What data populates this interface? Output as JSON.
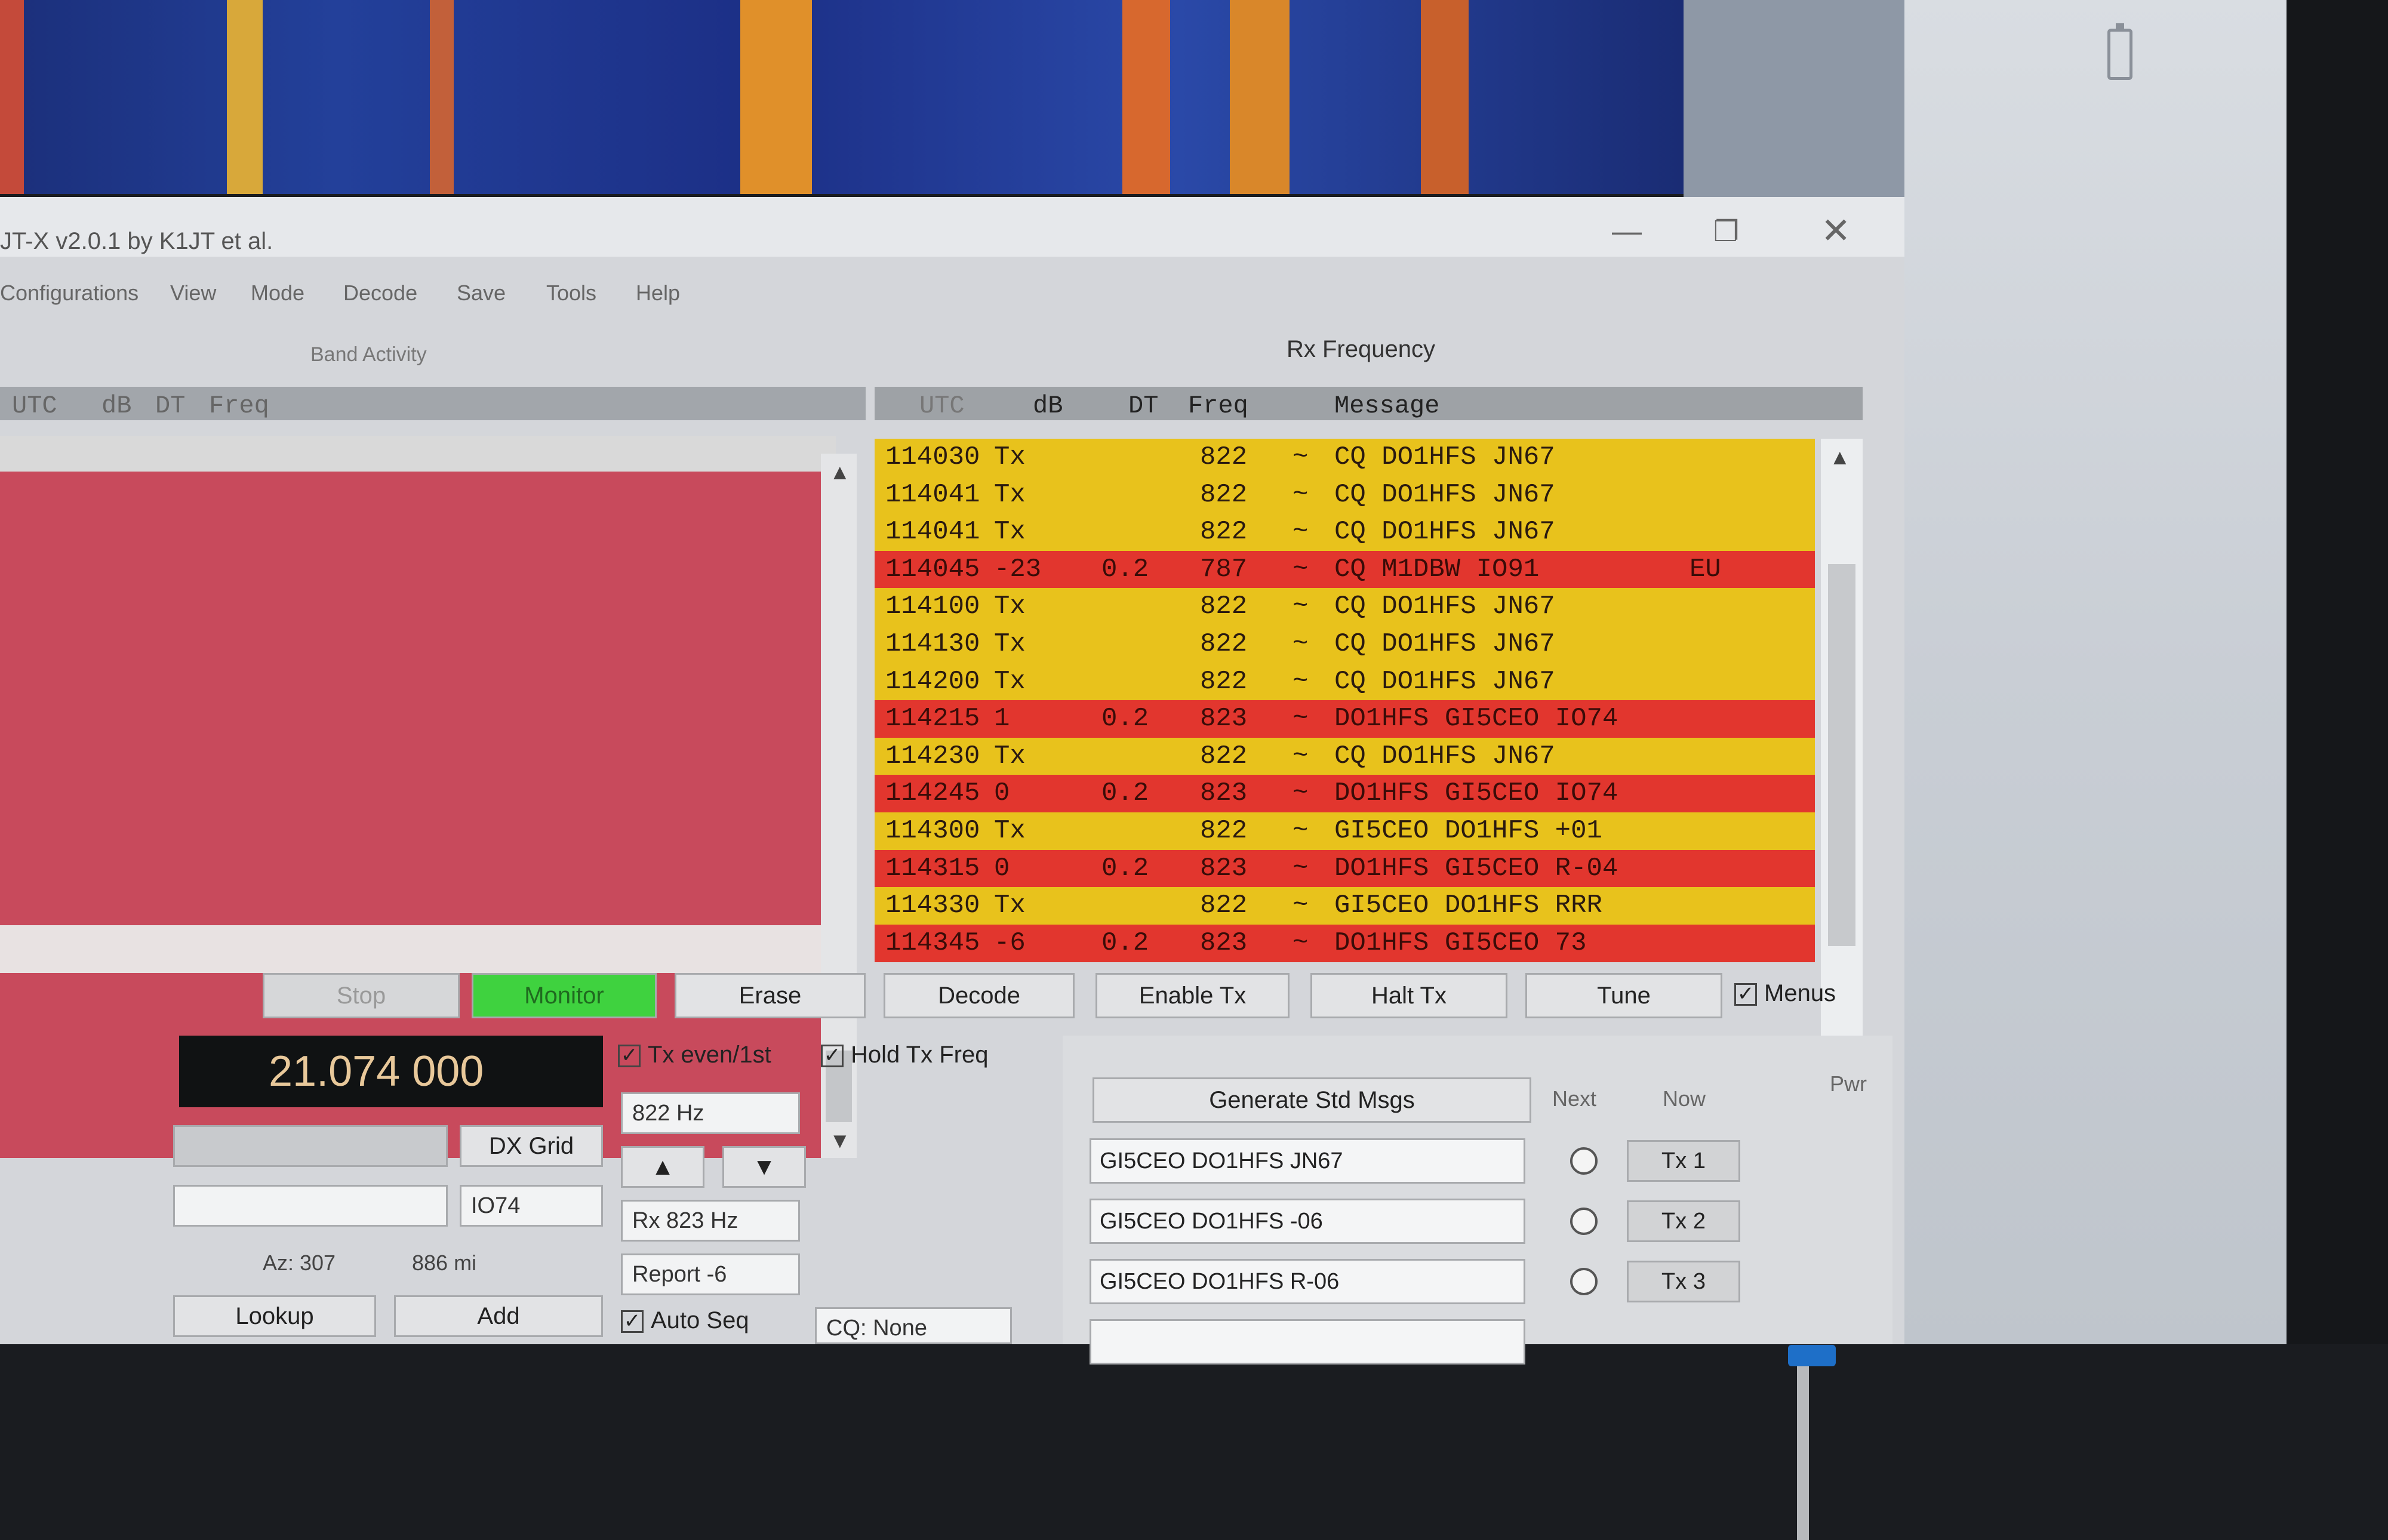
{
  "window": {
    "title": "JT-X  v2.0.1   by K1JT et al.",
    "controls": {
      "minimize": "—",
      "maximize": "❐",
      "close": "✕"
    }
  },
  "menu": [
    "Configurations",
    "View",
    "Mode",
    "Decode",
    "Save",
    "Tools",
    "Help"
  ],
  "panels": {
    "band_activity": "Band Activity",
    "rx_frequency": "Rx Frequency"
  },
  "band_activity_header": {
    "utc": "UTC",
    "db": "dB",
    "dt": "DT",
    "freq": "Freq"
  },
  "rx_table": {
    "headers": {
      "utc": "UTC",
      "db": "dB",
      "dt": "DT",
      "freq": "Freq",
      "message": "Message"
    },
    "rows": [
      {
        "utc": "114030",
        "db": "Tx",
        "dt": "",
        "freq": "822",
        "sep": "~",
        "message": "CQ DO1HFS JN67",
        "extra": "",
        "status": "tx"
      },
      {
        "utc": "114041",
        "db": "Tx",
        "dt": "",
        "freq": "822",
        "sep": "~",
        "message": "CQ DO1HFS JN67",
        "extra": "",
        "status": "tx"
      },
      {
        "utc": "114041",
        "db": "Tx",
        "dt": "",
        "freq": "822",
        "sep": "~",
        "message": "CQ DO1HFS JN67",
        "extra": "",
        "status": "tx"
      },
      {
        "utc": "114045",
        "db": "-23",
        "dt": "0.2",
        "freq": "787",
        "sep": "~",
        "message": "CQ M1DBW IO91",
        "extra": "EU",
        "status": "rx"
      },
      {
        "utc": "114100",
        "db": "Tx",
        "dt": "",
        "freq": "822",
        "sep": "~",
        "message": "CQ DO1HFS JN67",
        "extra": "",
        "status": "tx"
      },
      {
        "utc": "114130",
        "db": "Tx",
        "dt": "",
        "freq": "822",
        "sep": "~",
        "message": "CQ DO1HFS JN67",
        "extra": "",
        "status": "tx"
      },
      {
        "utc": "114200",
        "db": "Tx",
        "dt": "",
        "freq": "822",
        "sep": "~",
        "message": "CQ DO1HFS JN67",
        "extra": "",
        "status": "tx"
      },
      {
        "utc": "114215",
        "db": "1",
        "dt": "0.2",
        "freq": "823",
        "sep": "~",
        "message": "DO1HFS GI5CEO IO74",
        "extra": "",
        "status": "rx"
      },
      {
        "utc": "114230",
        "db": "Tx",
        "dt": "",
        "freq": "822",
        "sep": "~",
        "message": "CQ DO1HFS JN67",
        "extra": "",
        "status": "tx"
      },
      {
        "utc": "114245",
        "db": "0",
        "dt": "0.2",
        "freq": "823",
        "sep": "~",
        "message": "DO1HFS GI5CEO IO74",
        "extra": "",
        "status": "rx"
      },
      {
        "utc": "114300",
        "db": "Tx",
        "dt": "",
        "freq": "822",
        "sep": "~",
        "message": "GI5CEO DO1HFS +01",
        "extra": "",
        "status": "tx"
      },
      {
        "utc": "114315",
        "db": "0",
        "dt": "0.2",
        "freq": "823",
        "sep": "~",
        "message": "DO1HFS GI5CEO R-04",
        "extra": "",
        "status": "rx"
      },
      {
        "utc": "114330",
        "db": "Tx",
        "dt": "",
        "freq": "822",
        "sep": "~",
        "message": "GI5CEO DO1HFS RRR",
        "extra": "",
        "status": "tx"
      },
      {
        "utc": "114345",
        "db": "-6",
        "dt": "0.2",
        "freq": "823",
        "sep": "~",
        "message": "DO1HFS GI5CEO 73",
        "extra": "",
        "status": "rx"
      }
    ]
  },
  "colors": {
    "tx_row": "#e8c21c",
    "rx_row": "#e2362e",
    "monitor_on": "#3fd23f",
    "band_list": "#c84a5c"
  },
  "buttons": {
    "stop": "Stop",
    "monitor": "Monitor",
    "erase": "Erase",
    "decode": "Decode",
    "enable_tx": "Enable Tx",
    "halt_tx": "Halt Tx",
    "tune": "Tune",
    "menus": "Menus",
    "generate": "Generate Std Msgs",
    "dx_grid": "DX Grid",
    "lookup": "Lookup",
    "add": "Add"
  },
  "checks": {
    "tx_even": "Tx even/1st",
    "hold_tx": "Hold Tx Freq",
    "auto_seq": "Auto Seq"
  },
  "controls": {
    "dial_frequency": "21.074 000",
    "tx_freq": "822 Hz",
    "rx_freq": "Rx 823 Hz",
    "report": "Report -6",
    "grid": "IO74",
    "az_label": "Az: 307",
    "distance": "886 mi",
    "cq_select": "CQ: None"
  },
  "tx_panel": {
    "next_label": "Next",
    "now_label": "Now",
    "pwr_label": "Pwr",
    "messages": [
      {
        "text": "GI5CEO DO1HFS JN67",
        "button": "Tx 1"
      },
      {
        "text": "GI5CEO DO1HFS -06",
        "button": "Tx 2"
      },
      {
        "text": "GI5CEO DO1HFS R-06",
        "button": "Tx 3"
      }
    ]
  }
}
